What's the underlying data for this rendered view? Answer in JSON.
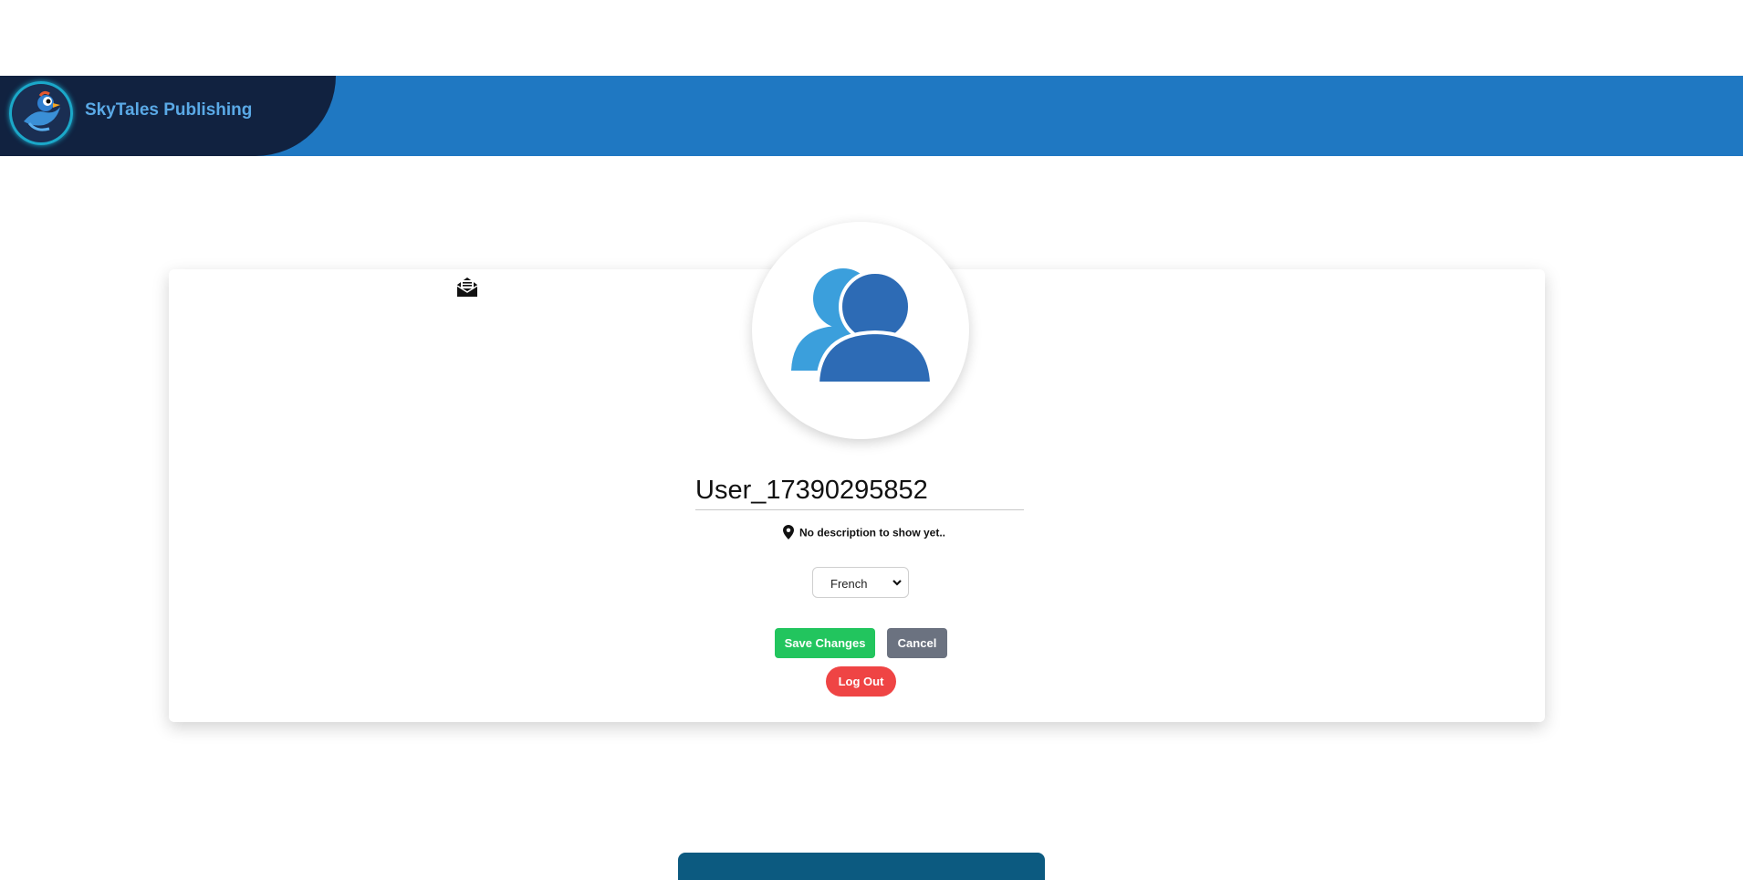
{
  "header": {
    "brand_name": "SkyTales Publishing",
    "background_color": "#1f78c2",
    "brand_panel_color": "#112240"
  },
  "profile": {
    "username": "User_17390295852",
    "description": "No description to show yet..",
    "language": {
      "selected": "French"
    }
  },
  "actions": {
    "save_label": "Save Changes",
    "cancel_label": "Cancel",
    "logout_label": "Log Out"
  },
  "colors": {
    "save": "#22c55e",
    "cancel": "#6b7280",
    "logout": "#ef4444",
    "footer_bar": "#0c5a80"
  },
  "icons": {
    "logo": "bird-logo-icon",
    "inbox": "mail-open-icon",
    "avatar": "users-icon",
    "location": "map-pin-icon",
    "select": "chevron-down-icon"
  }
}
